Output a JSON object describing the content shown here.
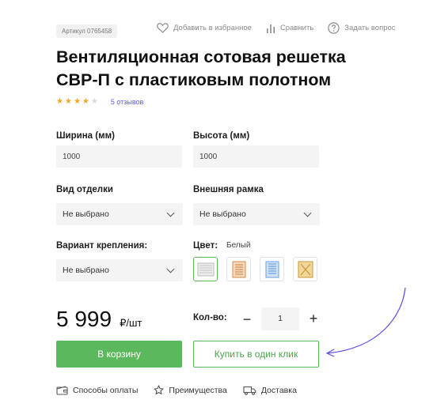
{
  "header": {
    "sku": "Артикул 0765458",
    "actions": [
      {
        "label": "Добавить в избранное",
        "icon": "heart-icon"
      },
      {
        "label": "Сравнить",
        "icon": "compare-icon"
      },
      {
        "label": "Задать вопрос",
        "icon": "question-icon"
      }
    ]
  },
  "product": {
    "title_line1": "Вентиляционная сотовая решетка",
    "title_line2": "СВР-П с пластиковым полотном",
    "rating": 4,
    "rating_max": 5,
    "reviews": "5 отзывов"
  },
  "options": {
    "width": {
      "label": "Ширина (мм)",
      "value": "1000"
    },
    "height": {
      "label": "Высота (мм)",
      "value": "1000"
    },
    "finish": {
      "label": "Вид отделки",
      "value": "Не выбрано"
    },
    "frame": {
      "label": "Внешняя рамка",
      "value": "Не выбрано"
    },
    "mount": {
      "label": "Вариант крепления:",
      "value": "Не выбрано"
    },
    "color": {
      "label": "Цвет:",
      "value": "Белый",
      "swatches": [
        {
          "name": "white",
          "color": "#e9e9e9",
          "active": true
        },
        {
          "name": "orange",
          "color": "#e8a56a",
          "active": false
        },
        {
          "name": "blue",
          "color": "#7faee8",
          "active": false
        },
        {
          "name": "gold",
          "color": "#e3b25a",
          "active": false
        }
      ]
    }
  },
  "purchase": {
    "price": "5 999",
    "unit": "₽/шт",
    "qty_label": "Кол-во:",
    "qty_value": "1",
    "minus": "−",
    "plus": "+",
    "cart_button": "В корзину",
    "oneclick_button": "Купить в один клик"
  },
  "footer_links": [
    {
      "label": "Способы оплаты",
      "icon": "wallet-icon"
    },
    {
      "label": "Преимущества",
      "icon": "star-icon"
    },
    {
      "label": "Доставка",
      "icon": "truck-icon"
    }
  ],
  "colors": {
    "accent": "#5cb85c",
    "link": "#5b5ee8",
    "star": "#f5a623",
    "annotation": "#5b4ee0"
  }
}
